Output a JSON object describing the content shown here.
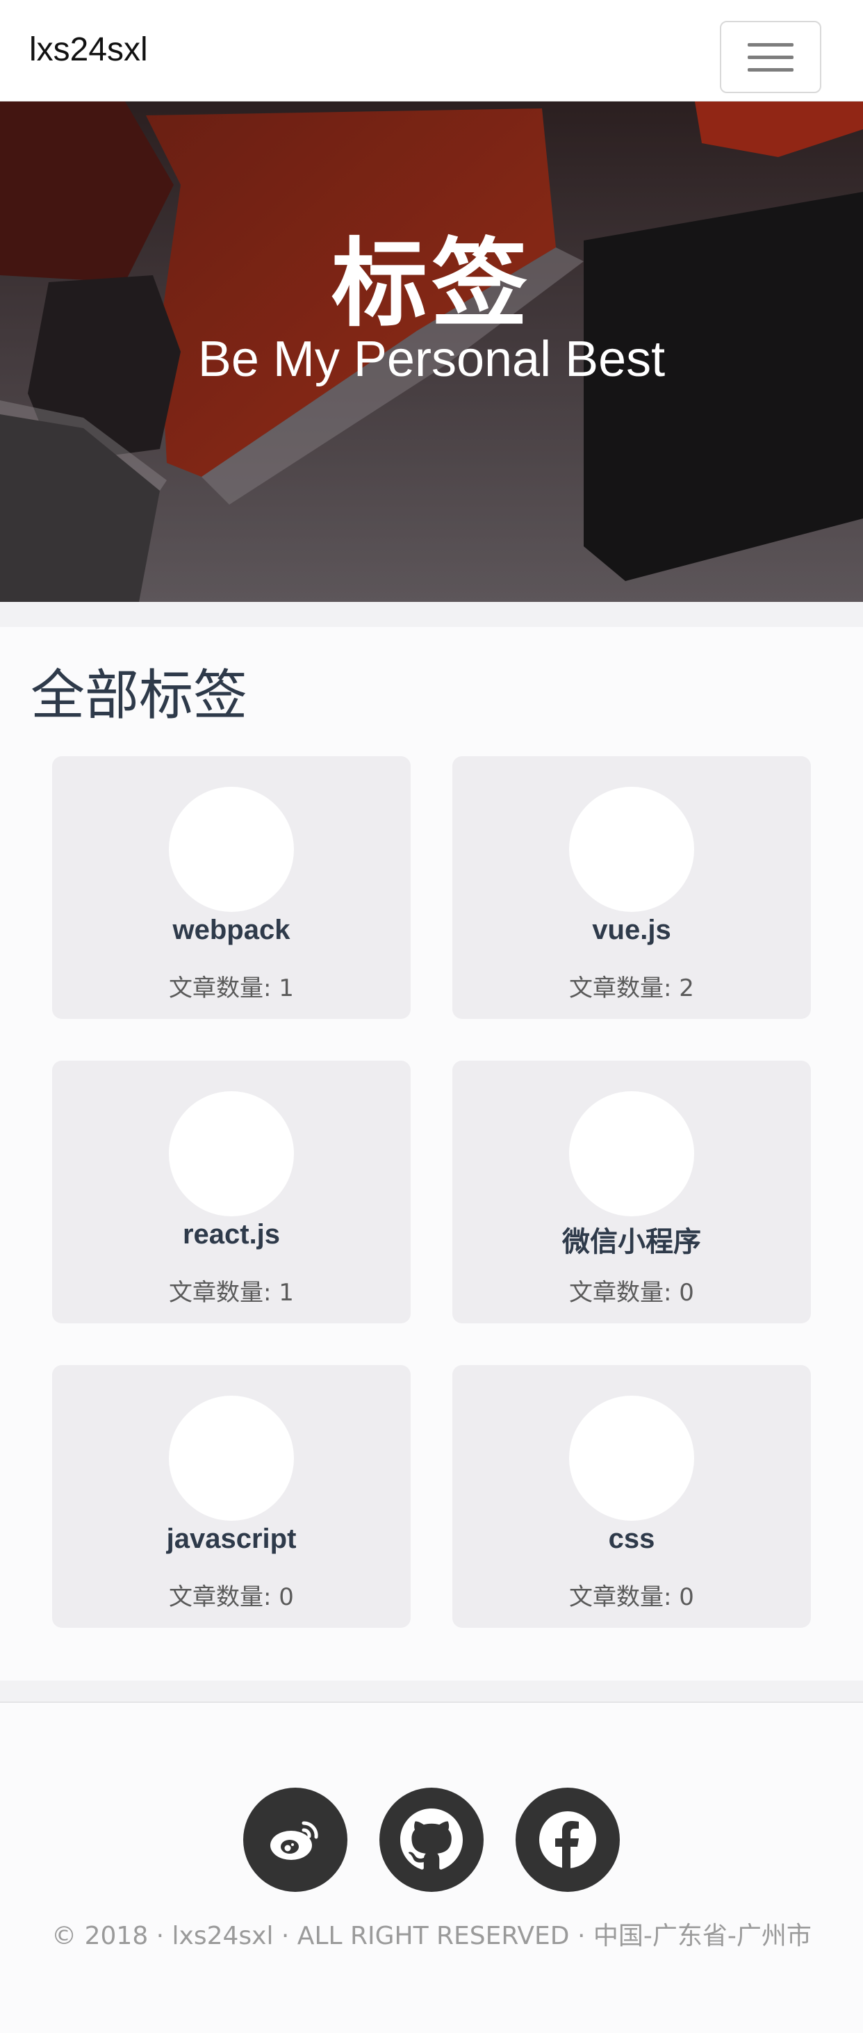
{
  "navbar": {
    "brand": "lxs24sxl",
    "toggle_icon": "hamburger-menu-icon"
  },
  "hero": {
    "title": "标签",
    "subtitle": "Be My Personal Best"
  },
  "tags_section": {
    "title": "全部标签",
    "tags": [
      {
        "name": "webpack",
        "count_label": "文章数量: 1"
      },
      {
        "name": "vue.js",
        "count_label": "文章数量: 2"
      },
      {
        "name": "react.js",
        "count_label": "文章数量: 1"
      },
      {
        "name": "微信小程序",
        "count_label": "文章数量: 0"
      },
      {
        "name": "javascript",
        "count_label": "文章数量: 0"
      },
      {
        "name": "css",
        "count_label": "文章数量: 0"
      }
    ]
  },
  "footer": {
    "social": [
      {
        "icon": "weibo-icon"
      },
      {
        "icon": "github-icon"
      },
      {
        "icon": "facebook-icon"
      }
    ],
    "copyright": "© 2018 · lxs24sxl · ALL RIGHT RESERVED · 中国-广东省-广州市"
  },
  "colors": {
    "hero_key_red": "#b3321c",
    "text_dark": "#2e3a4a",
    "card_bg": "#eeedf0",
    "social_bg": "#333333"
  }
}
